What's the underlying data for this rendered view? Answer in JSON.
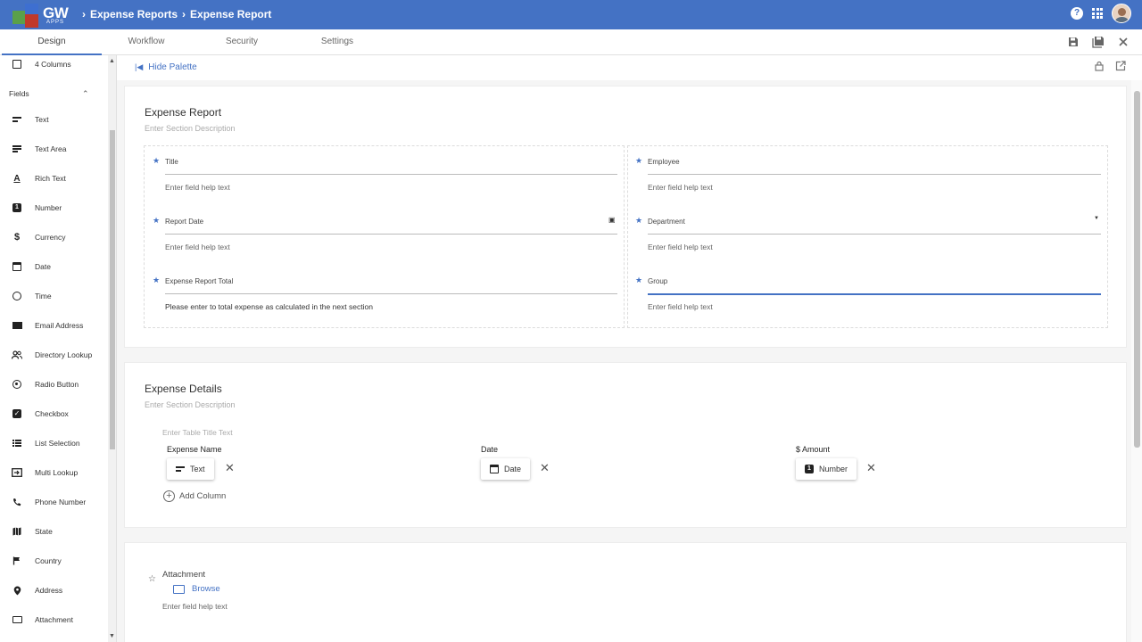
{
  "app": {
    "logo_text": "GW",
    "logo_sub": "APPS",
    "breadcrumbs": [
      "Expense Reports",
      "Expense Report"
    ]
  },
  "tabs": [
    "Design",
    "Workflow",
    "Security",
    "Settings"
  ],
  "sidebar": {
    "top_item": "4 Columns",
    "section_label": "Fields",
    "items": [
      {
        "label": "Text",
        "icon": "text-lines-icon"
      },
      {
        "label": "Text Area",
        "icon": "text-area-icon"
      },
      {
        "label": "Rich Text",
        "icon": "rich-text-icon"
      },
      {
        "label": "Number",
        "icon": "number-icon"
      },
      {
        "label": "Currency",
        "icon": "dollar-icon"
      },
      {
        "label": "Date",
        "icon": "calendar-icon"
      },
      {
        "label": "Time",
        "icon": "clock-icon"
      },
      {
        "label": "Email Address",
        "icon": "envelope-icon"
      },
      {
        "label": "Directory Lookup",
        "icon": "people-icon"
      },
      {
        "label": "Radio Button",
        "icon": "radio-icon"
      },
      {
        "label": "Checkbox",
        "icon": "checkbox-icon"
      },
      {
        "label": "List Selection",
        "icon": "list-icon"
      },
      {
        "label": "Multi Lookup",
        "icon": "multi-lookup-icon"
      },
      {
        "label": "Phone Number",
        "icon": "phone-icon"
      },
      {
        "label": "State",
        "icon": "map-icon"
      },
      {
        "label": "Country",
        "icon": "flag-icon"
      },
      {
        "label": "Address",
        "icon": "pin-icon"
      },
      {
        "label": "Attachment",
        "icon": "folder-icon"
      }
    ]
  },
  "palette": {
    "hide_label": "Hide Palette"
  },
  "section1": {
    "title": "Expense Report",
    "desc": "Enter Section Description",
    "fields": [
      {
        "label": "Title",
        "help": "Enter field help text"
      },
      {
        "label": "Report Date",
        "help": "Enter field help text"
      },
      {
        "label": "Expense Report Total",
        "help": "Please enter to total expense as calculated in the next section"
      },
      {
        "label": "Employee",
        "help": "Enter field help text"
      },
      {
        "label": "Department",
        "help": "Enter field help text"
      },
      {
        "label": "Group",
        "help": "Enter field help text"
      }
    ]
  },
  "section2": {
    "title": "Expense Details",
    "desc": "Enter Section Description",
    "table_title_placeholder": "Enter Table Title Text",
    "columns": [
      {
        "header": "Expense Name",
        "chip": "Text"
      },
      {
        "header": "Date",
        "chip": "Date"
      },
      {
        "header": "$ Amount",
        "chip": "Number"
      }
    ],
    "add_column": "Add Column"
  },
  "section3": {
    "label": "Attachment",
    "browse": "Browse",
    "help": "Enter field help text"
  },
  "colors": {
    "accent": "#4472c4",
    "header_bg": "#4472c4"
  }
}
